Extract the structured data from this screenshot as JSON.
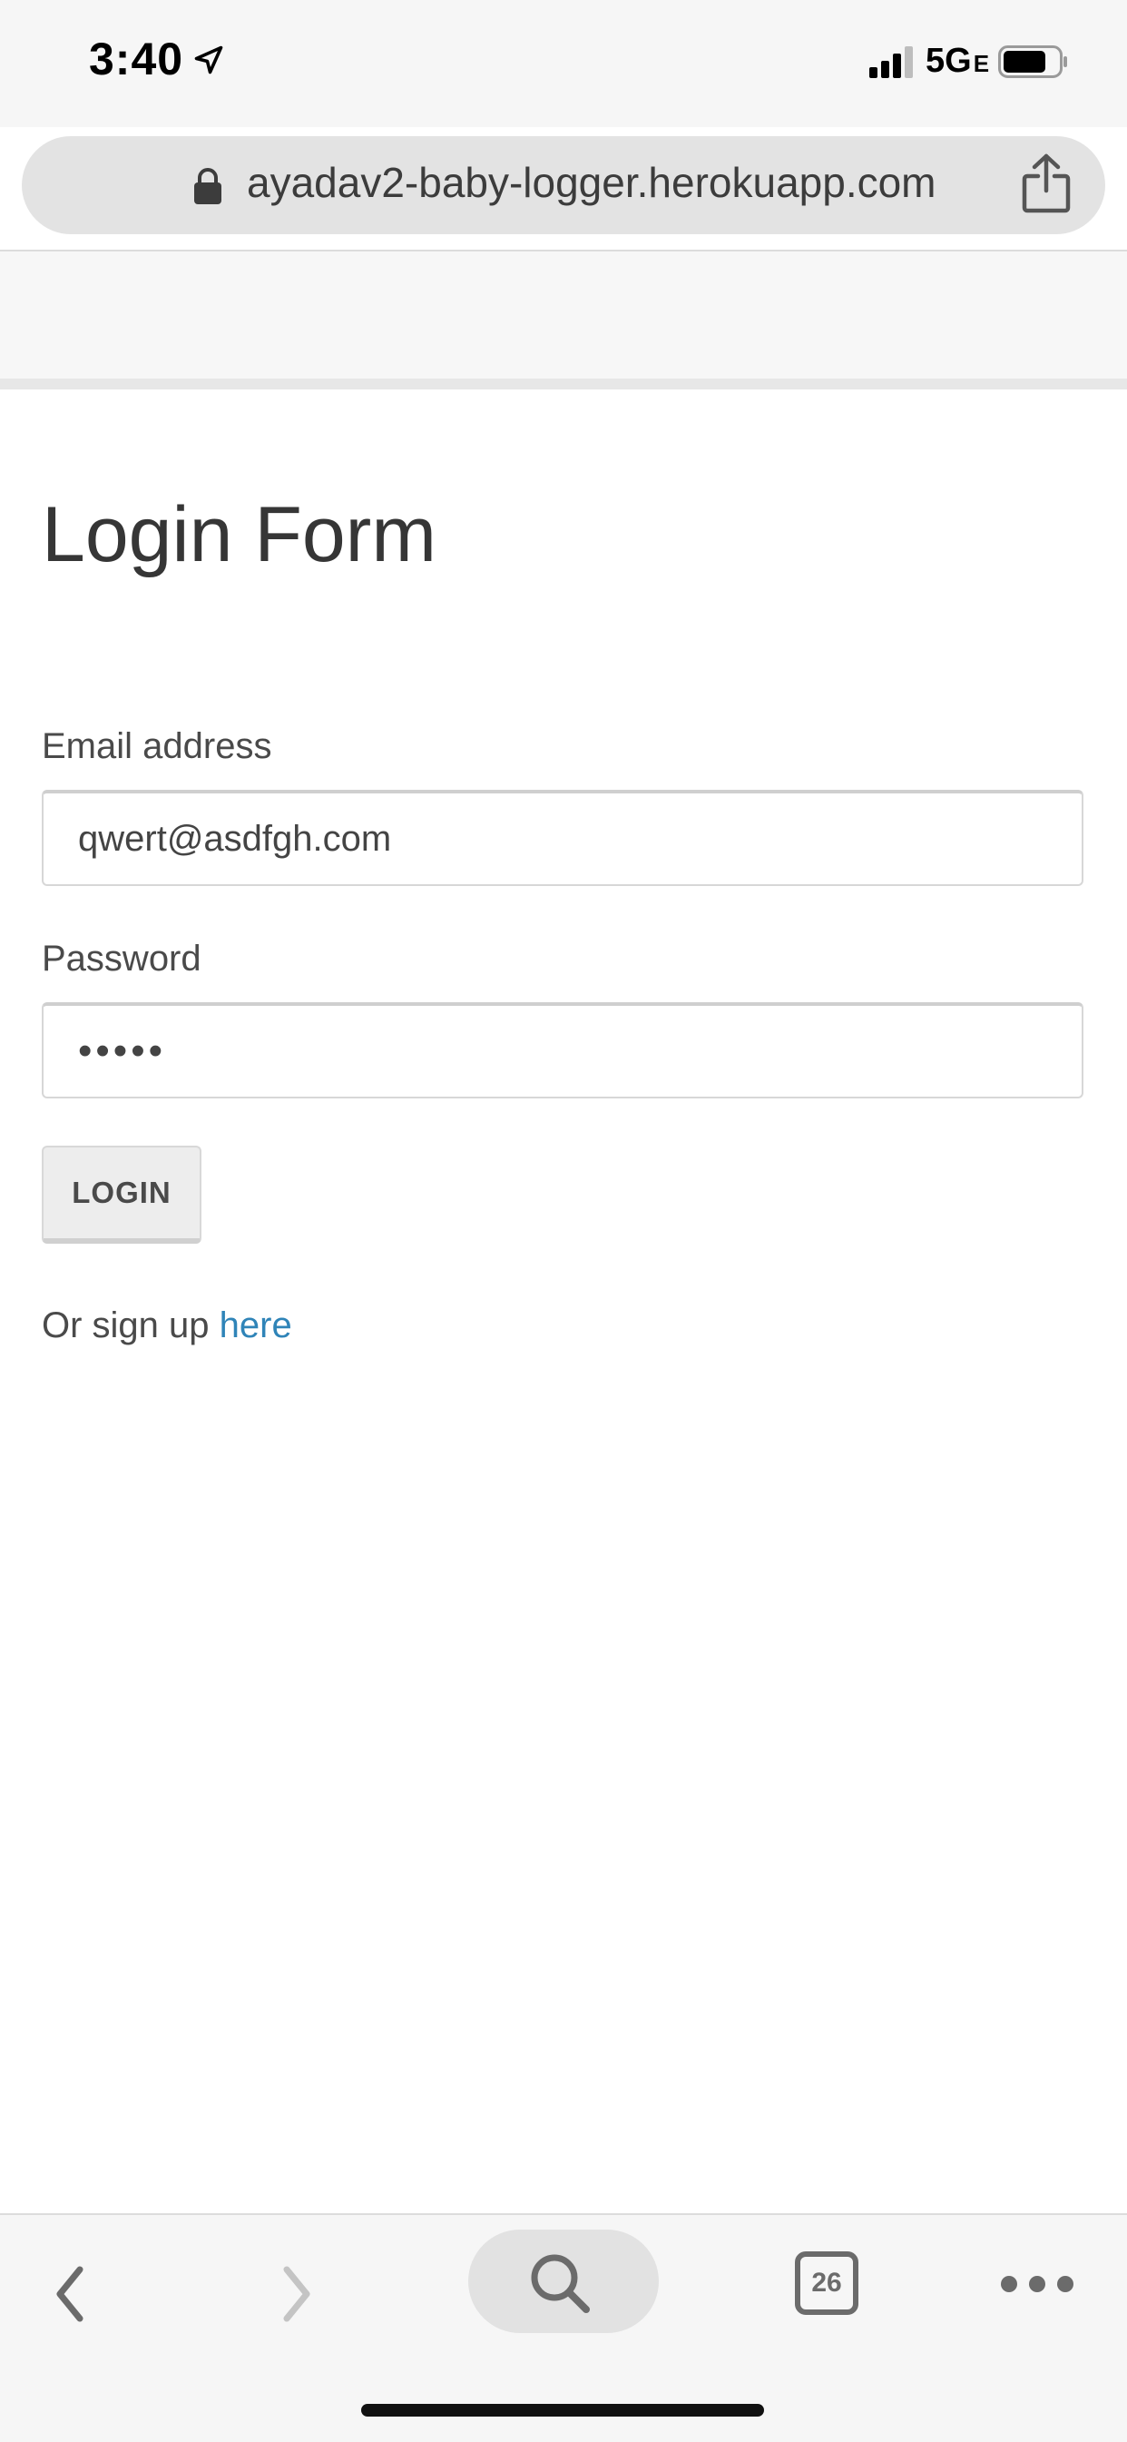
{
  "status_bar": {
    "time": "3:40",
    "network": "5G",
    "network_sub": "E"
  },
  "browser": {
    "url": "ayadav2-baby-logger.herokuapp.com",
    "tab_count": "26"
  },
  "page": {
    "title": "Login Form",
    "email_label": "Email address",
    "email_value": "qwert@asdfgh.com",
    "password_label": "Password",
    "password_value": "•••••",
    "login_button": "LOGIN",
    "signup_prefix": "Or sign up ",
    "signup_link": "here"
  },
  "colors": {
    "link": "#2f84b8",
    "button_bg": "#ededed"
  },
  "icons": {
    "location": "location-arrow-icon",
    "signal": "signal-bars-icon",
    "battery": "battery-icon",
    "lock": "lock-icon",
    "share": "share-icon",
    "back": "chevron-left-icon",
    "forward": "chevron-right-icon",
    "search": "search-icon",
    "tabs": "tabs-icon",
    "more": "more-icon"
  }
}
